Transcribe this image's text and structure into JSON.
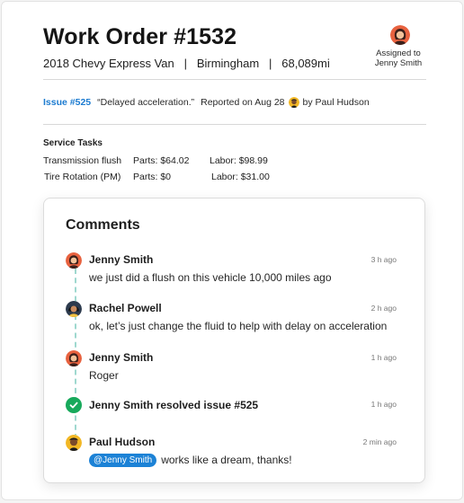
{
  "work_order": {
    "title": "Work Order #1532",
    "vehicle": "2018 Chevy Express Van",
    "location": "Birmingham",
    "mileage": "68,089mi",
    "assigned_label_line1": "Assigned to",
    "assigned_label_line2": "Jenny Smith"
  },
  "issue": {
    "link": "Issue #525",
    "quote": "“Delayed acceleration.”",
    "reported": "Reported on Aug 28",
    "by": "by Paul Hudson"
  },
  "service_tasks": {
    "heading": "Service Tasks",
    "rows": [
      {
        "name": "Transmission flush",
        "parts": "Parts: $64.02",
        "labor": "Labor: $98.99"
      },
      {
        "name": "Tire Rotation (PM)",
        "parts": "Parts: $0",
        "labor": "Labor: $31.00"
      }
    ]
  },
  "comments": {
    "title": "Comments",
    "items": [
      {
        "author": "Jenny Smith",
        "time": "3 h ago",
        "text": "we just did a flush on this vehicle 10,000 miles ago",
        "avatar_icon": "jenny-avatar"
      },
      {
        "author": "Rachel Powell",
        "time": "2 h ago",
        "text": "ok, let’s just change the fluid to help with delay on acceleration",
        "avatar_icon": "rachel-avatar"
      },
      {
        "author": "Jenny Smith",
        "time": "1 h ago",
        "text": "Roger",
        "avatar_icon": "jenny-avatar"
      },
      {
        "author": "Jenny Smith resolved issue #525",
        "time": "1 h ago",
        "text": "",
        "avatar_icon": "check-circle-icon"
      },
      {
        "author": "Paul Hudson",
        "time": "2 min ago",
        "mention": "@Jenny Smith",
        "text": "works like a dream, thanks!",
        "avatar_icon": "paul-avatar"
      }
    ]
  },
  "colors": {
    "link_blue": "#1c7bd0",
    "mention_blue": "#1c82d6",
    "resolved_green": "#17a95b",
    "timeline_teal": "#9fd8cf"
  }
}
